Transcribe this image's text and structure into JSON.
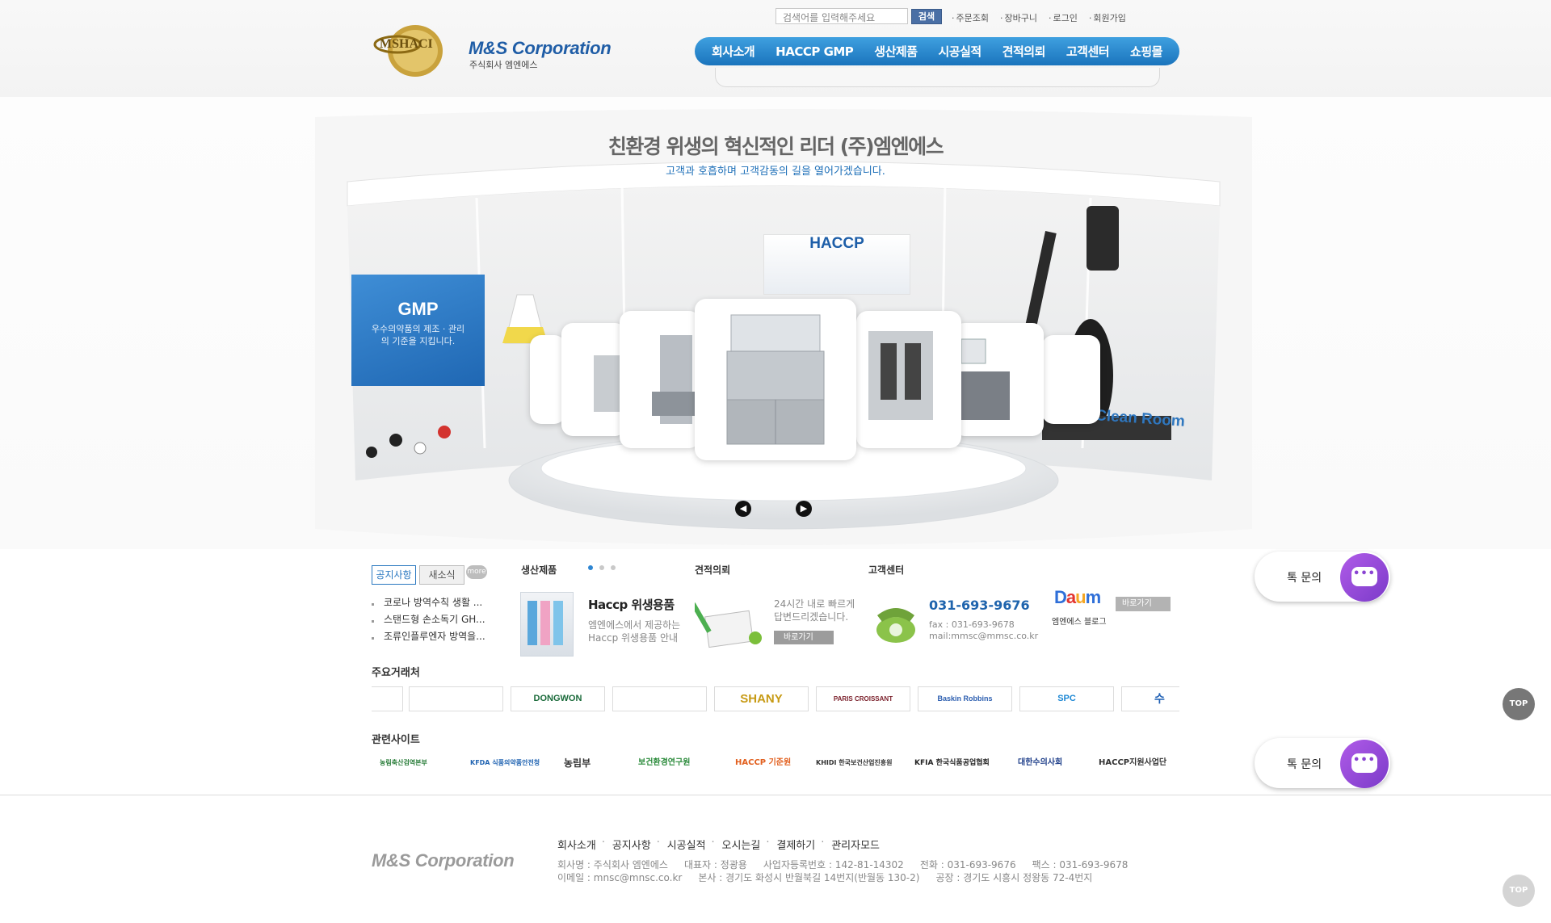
{
  "header": {
    "logo_text": "M&S Corporation",
    "logo_sub": "주식회사 엠엔에스",
    "search_placeholder": "검색어를 입력해주세요",
    "search_button": "검색",
    "util_links": [
      "주문조회",
      "장바구니",
      "로그인",
      "회원가입"
    ],
    "gnb": [
      "회사소개",
      "HACCP GMP",
      "생산제품",
      "시공실적",
      "견적의뢰",
      "고객센터",
      "쇼핑몰"
    ]
  },
  "hero": {
    "title": "친환경 위생의 혁신적인 리더 (주)엠엔에스",
    "subtitle": "고객과 호흡하며 고객감동의 길을 열어가겠습니다.",
    "gmp_title": "GMP",
    "gmp_desc": "우수의약품의 제조 · 관리의 기준을 지킵니다.",
    "haccp_label": "HACCP",
    "clean_label": "Clean Room",
    "prev_icon": "chevron-left-icon",
    "next_icon": "chevron-right-icon"
  },
  "notice": {
    "tabs": [
      "공지사항",
      "새소식"
    ],
    "more": "more",
    "items": [
      "코로나 방역수칙 생활 ...",
      "스탠드형 손소독기 GH...",
      "조류인플루엔자 방역을..."
    ]
  },
  "products": {
    "title": "생산제품",
    "headline": "Haccp 위생용품",
    "desc": "엠엔에스에서 제공하는 Haccp 위생용품 안내"
  },
  "quote": {
    "title": "견적의뢰",
    "desc": "24시간 내로 빠르게 답변드리겠습니다.",
    "button": "바로가기"
  },
  "cs": {
    "title": "고객센터",
    "tel": "031-693-9676",
    "fax": "fax : 031-693-9678",
    "mail": "mail:mmsc@mmsc.co.kr",
    "blog_label": "엠엔에스 블로그",
    "blog_button": "바로가기"
  },
  "chat": {
    "label": "톡 문의"
  },
  "top_button": "TOP",
  "clients": {
    "title": "주요거래처",
    "logos": [
      "",
      "",
      "DONGWON",
      "",
      "SHANY",
      "PARIS CROISSANT",
      "Baskin Robbins",
      "SPC",
      "수"
    ]
  },
  "related": {
    "title": "관련사이트",
    "sites": [
      "농림축산검역본부",
      "KFDA 식품의약품안전청",
      "농림부",
      "보건환경연구원",
      "HACCP 기준원",
      "KHIDI 한국보건산업진흥원",
      "KFIA 한국식품공업협회",
      "대한수의사회",
      "HACCP지원사업단"
    ]
  },
  "footer": {
    "logo": "M&S Corporation",
    "nav": [
      "회사소개",
      "공지사항",
      "시공실적",
      "오시는길",
      "결제하기",
      "관리자모드"
    ],
    "company": "회사명 : 주식회사 엠엔에스",
    "ceo": "대표자 : 정광용",
    "biz_no": "사업자등록번호 : 142-81-14302",
    "tel": "전화 : 031-693-9676",
    "fax": "팩스 : 031-693-9678",
    "email": "이메일 : mnsc@mnsc.co.kr",
    "hq": "본사 : 경기도 화성시 반월북길 14번지(반월동 130-2)",
    "factory": "공장 : 경기도 시흥시 정왕동 72-4번지"
  },
  "colors": {
    "brand_blue": "#1f5da6",
    "gnb_blue": "#2a86cf",
    "chat_purple": "#8a44d2"
  }
}
